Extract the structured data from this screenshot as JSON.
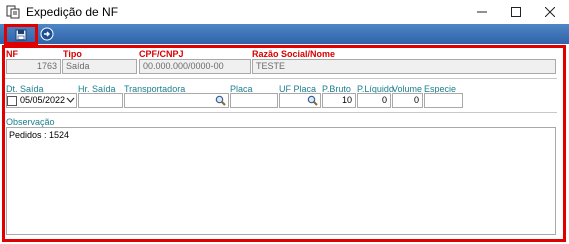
{
  "window": {
    "title": "Expedição de NF"
  },
  "header_fields": {
    "nf": {
      "label": "NF",
      "value": "1763"
    },
    "tipo": {
      "label": "Tipo",
      "value": "Saída"
    },
    "cpf_cnpj": {
      "label": "CPF/CNPJ",
      "value": "00.000.000/0000-00"
    },
    "razao_social": {
      "label": "Razão Social/Nome",
      "value": "TESTE"
    }
  },
  "shipping_fields": {
    "dt_saida": {
      "label": "Dt. Saída",
      "value": "05/05/2022"
    },
    "hr_saida": {
      "label": "Hr. Saída",
      "value": ""
    },
    "transportadora": {
      "label": "Transportadora",
      "value": ""
    },
    "placa": {
      "label": "Placa",
      "value": ""
    },
    "uf_placa": {
      "label": "UF Placa",
      "value": ""
    },
    "p_bruto": {
      "label": "P.Bruto",
      "value": "10"
    },
    "p_liquido": {
      "label": "P.Líquido",
      "value": "0"
    },
    "volume": {
      "label": "Volume",
      "value": "0"
    },
    "especie": {
      "label": "Especie",
      "value": ""
    }
  },
  "observacao": {
    "label": "Observação",
    "value": "Pedidos : 1524"
  },
  "icons": {
    "app": "document-icon",
    "save": "save-icon",
    "exit": "exit-icon",
    "search": "magnifier-icon"
  },
  "colors": {
    "accent_red": "#e00000",
    "label_teal": "#1a7f8f",
    "toolbar_blue": "#3a70b4"
  }
}
